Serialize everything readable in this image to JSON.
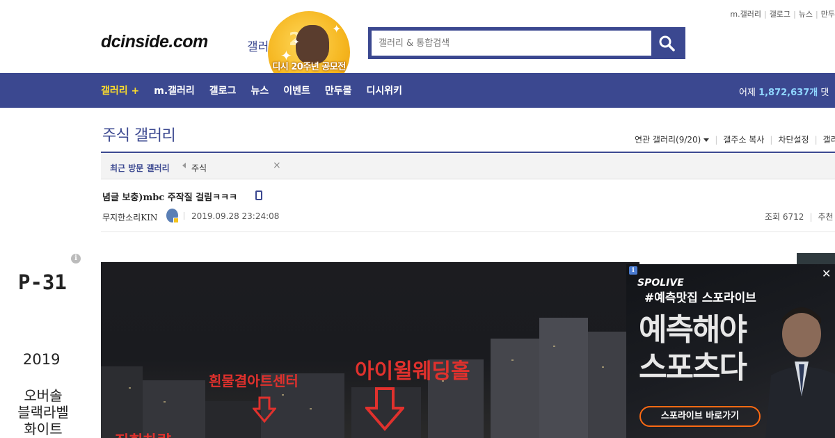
{
  "top_links": [
    "m.갤러리",
    "갤로그",
    "뉴스",
    "만두"
  ],
  "header": {
    "logo": "dcinside.com",
    "logo_sub": "갤러리",
    "badge_text": "디시 20주년 공모전",
    "badge_number": "20",
    "search_placeholder": "갤러리 & 통합검색"
  },
  "nav": {
    "items": [
      "갤러리 +",
      "m.갤러리",
      "갤로그",
      "뉴스",
      "이벤트",
      "만두몰",
      "디시위키"
    ],
    "stat_label": "어제",
    "stat_value": "1,872,637개",
    "stat_suffix": "댓"
  },
  "gallery": {
    "title": "주식 갤러리",
    "menu": [
      "연관 갤러리(9/20)",
      "갤주소 복사",
      "차단설정",
      "갤러"
    ],
    "recent_label": "최근 방문 갤러리",
    "recent_item": "주식",
    "recent_close": "×"
  },
  "post": {
    "title": "념글 보충)mbc 주작질 걸림ㅋㅋㅋ",
    "author": "무지한소리KIN",
    "date": "2019.09.28 23:24:08",
    "views": "조회 6712",
    "recommend": "추천"
  },
  "left_ad": {
    "info": "i",
    "model": "P-31",
    "year": "2019",
    "line1": "오버솔",
    "line2": "블랙라벨",
    "line3": "화이트"
  },
  "photo": {
    "label1": "흰물결아트센터",
    "label2": "아이윌웨딩홀",
    "label3": "집회차량"
  },
  "right_ad": {
    "info": "i",
    "brand": "SPOLIVE",
    "hashtag": "#예측맛집 스포라이브",
    "headline1": "예측해야",
    "headline2": "스포츠다",
    "button": "스포라이브 바로가기",
    "close": "✕"
  },
  "colors": {
    "brand": "#3b4890",
    "nav_active": "#ffdf2a",
    "stat_value": "#8fd6ff",
    "ad_accent": "#ff6a13",
    "photo_label": "#e0312d"
  }
}
